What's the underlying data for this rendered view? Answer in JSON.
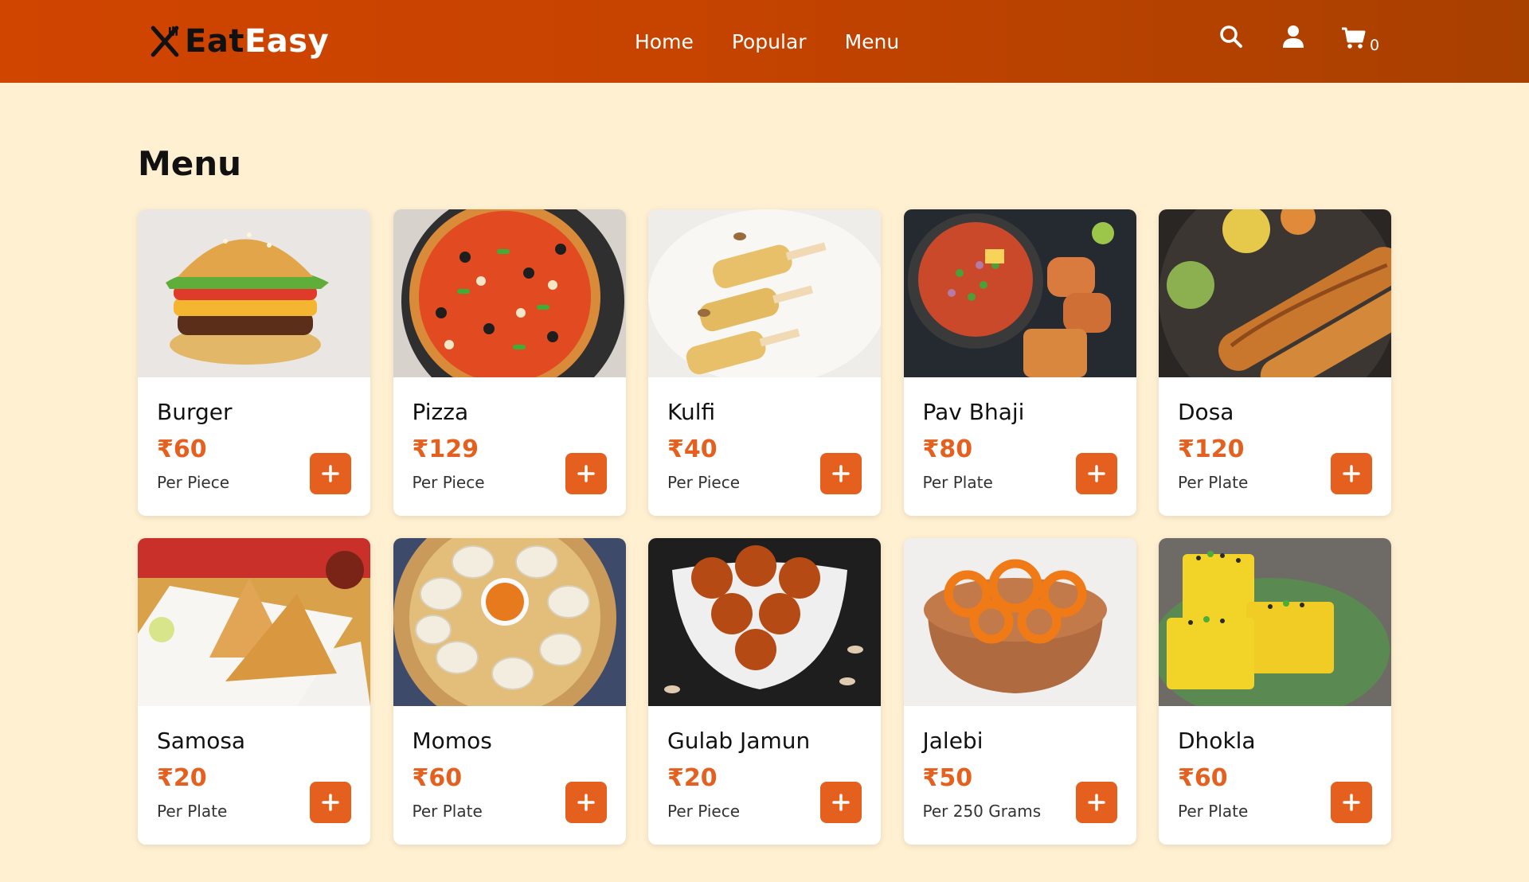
{
  "brand": {
    "part1": "Eat",
    "part2": "Easy",
    "logo_icon": "fork-knife-icon"
  },
  "nav": {
    "links": [
      "Home",
      "Popular",
      "Menu"
    ]
  },
  "header_icons": {
    "search": "search-icon",
    "user": "user-icon",
    "cart": "cart-icon",
    "cart_count": "0"
  },
  "colors": {
    "accent": "#e5601e",
    "navbar_start": "#d04500",
    "navbar_end": "#a84000",
    "background": "#fff0d1"
  },
  "section_title": "Menu",
  "items": [
    {
      "name": "Burger",
      "price": "₹60",
      "unit": "Per Piece"
    },
    {
      "name": "Pizza",
      "price": "₹129",
      "unit": "Per Piece"
    },
    {
      "name": "Kulfi",
      "price": "₹40",
      "unit": "Per Piece"
    },
    {
      "name": "Pav Bhaji",
      "price": "₹80",
      "unit": "Per Plate"
    },
    {
      "name": "Dosa",
      "price": "₹120",
      "unit": "Per Plate"
    },
    {
      "name": "Samosa",
      "price": "₹20",
      "unit": "Per Plate"
    },
    {
      "name": "Momos",
      "price": "₹60",
      "unit": "Per Plate"
    },
    {
      "name": "Gulab Jamun",
      "price": "₹20",
      "unit": "Per Piece"
    },
    {
      "name": "Jalebi",
      "price": "₹50",
      "unit": "Per 250 Grams"
    },
    {
      "name": "Dhokla",
      "price": "₹60",
      "unit": "Per Plate"
    }
  ]
}
